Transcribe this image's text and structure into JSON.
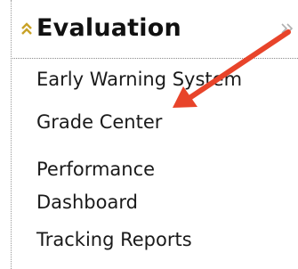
{
  "menu": {
    "section_title": "Evaluation",
    "items": [
      {
        "label": "Early Warning System"
      },
      {
        "label": "Grade Center"
      },
      {
        "label": "Performance Dashboard"
      },
      {
        "label": "Tracking Reports"
      }
    ]
  },
  "icons": {
    "collapse": "double-chevron-up-icon",
    "expand": "double-chevron-right-icon",
    "annotation": "red-arrow-annotation"
  },
  "colors": {
    "collapse_icon": "#c9a227",
    "arrow": "#e8442a",
    "text": "#1a1a1a",
    "divider": "#8a8a8a"
  }
}
